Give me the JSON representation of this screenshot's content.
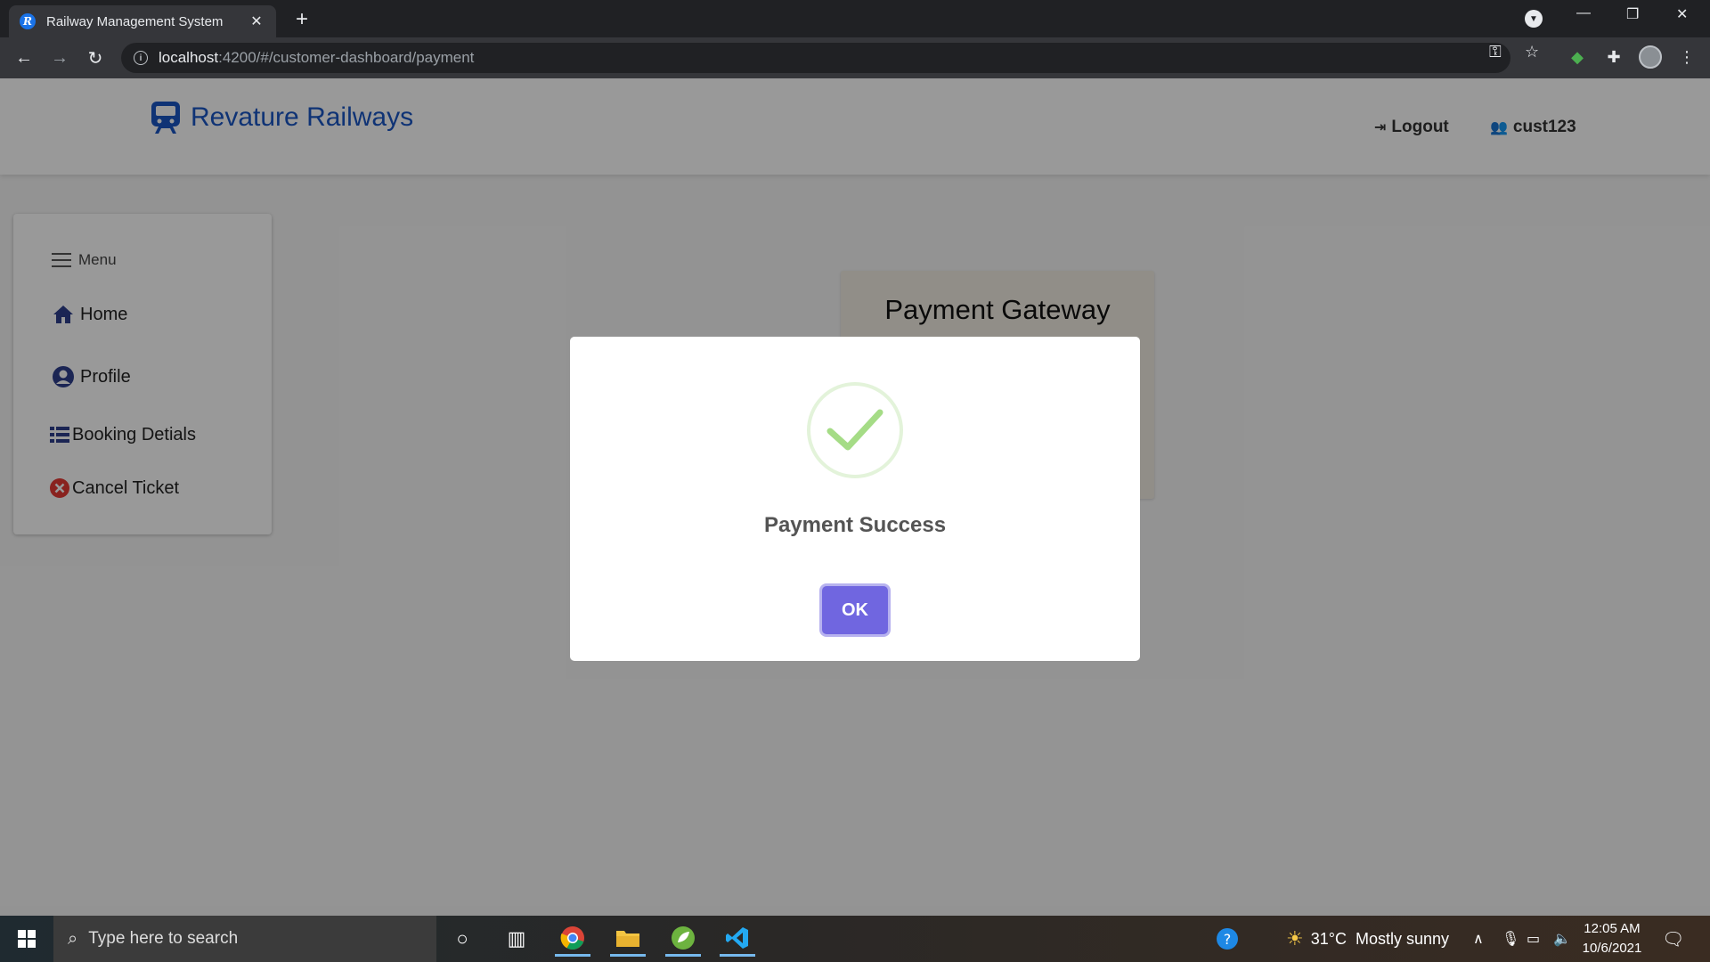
{
  "browser": {
    "tab_title": "Railway Management System",
    "tab_close": "✕",
    "new_tab": "+",
    "url_host": "localhost",
    "url_path": ":4200/#/customer-dashboard/payment"
  },
  "app": {
    "brand": "Revature Railways",
    "logout_label": "Logout",
    "username": "cust123"
  },
  "sidebar": {
    "menu_label": "Menu",
    "items": [
      {
        "label": "Home",
        "icon": "home-icon"
      },
      {
        "label": "Profile",
        "icon": "user-circle-icon"
      },
      {
        "label": "Booking Detials",
        "icon": "list-icon"
      },
      {
        "label": "Cancel Ticket",
        "icon": "cancel-icon"
      }
    ]
  },
  "gateway": {
    "title": "Payment Gateway"
  },
  "modal": {
    "message": "Payment Success",
    "ok_label": "OK"
  },
  "taskbar": {
    "search_placeholder": "Type here to search",
    "weather_temp": "31°C",
    "weather_desc": "Mostly sunny",
    "time": "12:05 AM",
    "date": "10/6/2021"
  },
  "colors": {
    "brand_blue": "#1a56c4",
    "ok_button": "#7066e0",
    "success_green": "#a5dc86"
  }
}
